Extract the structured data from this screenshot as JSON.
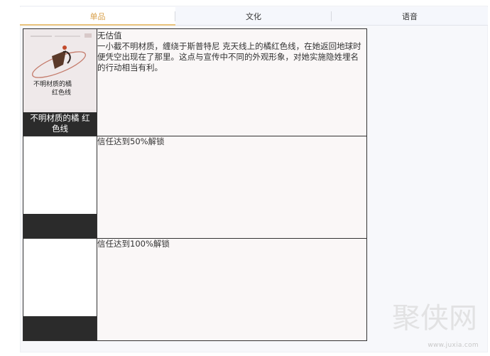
{
  "tabs": [
    {
      "label": "单品",
      "active": true
    },
    {
      "label": "文化",
      "active": false
    },
    {
      "label": "语音",
      "active": false
    }
  ],
  "items": [
    {
      "name": "不明材质的橘 红色线",
      "thumb_text_1": "不明材质的橘",
      "thumb_text_2": "红色线",
      "value": "无估值",
      "description": "一小截不明材质，缠绕于斯普特尼 克天线上的橘红色线，在她返回地球时便凭空出现在了那里。这点与宣传中不同的外观形象，对她实施隐姓埋名的行动相当有利。"
    },
    {
      "name": "",
      "unlock": "信任达到50%解锁"
    },
    {
      "name": "",
      "unlock": "信任达到100%解锁"
    }
  ],
  "watermark": {
    "text": "聚侠网",
    "url": "www.juxia.com"
  },
  "colors": {
    "active_tab_text": "#d9a24e",
    "active_tab_underline": "#e8c27a",
    "caption_bg": "#2b2b2b"
  }
}
